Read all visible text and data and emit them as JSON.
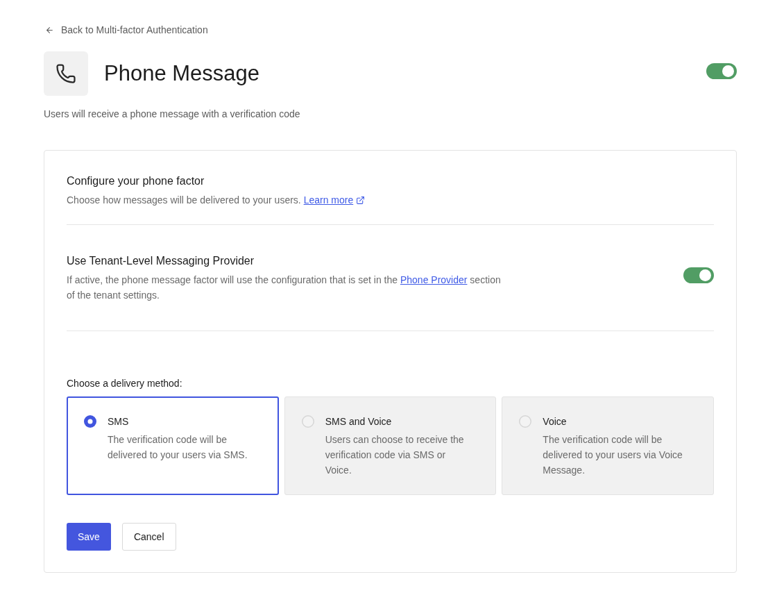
{
  "back_link": {
    "label": "Back to Multi-factor Authentication"
  },
  "header": {
    "title": "Phone Message",
    "enabled": true,
    "description": "Users will receive a phone message with a verification code"
  },
  "configure": {
    "title": "Configure your phone factor",
    "description": "Choose how messages will be delivered to your users.",
    "link": "Learn more"
  },
  "tenant_provider": {
    "title": "Use Tenant-Level Messaging Provider",
    "description_start": "If active, the phone message factor will use the configuration that is set in the",
    "link": "Phone Provider",
    "description_end": "section of the tenant settings.",
    "on": true
  },
  "delivery": {
    "label": "Choose a delivery method:",
    "options": [
      {
        "title": "SMS",
        "description": "The verification code will be delivered to your users via SMS.",
        "selected": true
      },
      {
        "title": "SMS and Voice",
        "description": "Users can choose to receive the verification code via SMS or Voice.",
        "selected": false
      },
      {
        "title": "Voice",
        "description": "The verification code will be delivered to your users via Voice Message.",
        "selected": false
      }
    ]
  },
  "actions": [
    {
      "label": "Save",
      "kind": "primary"
    },
    {
      "label": "Cancel",
      "kind": "secondary"
    }
  ]
}
